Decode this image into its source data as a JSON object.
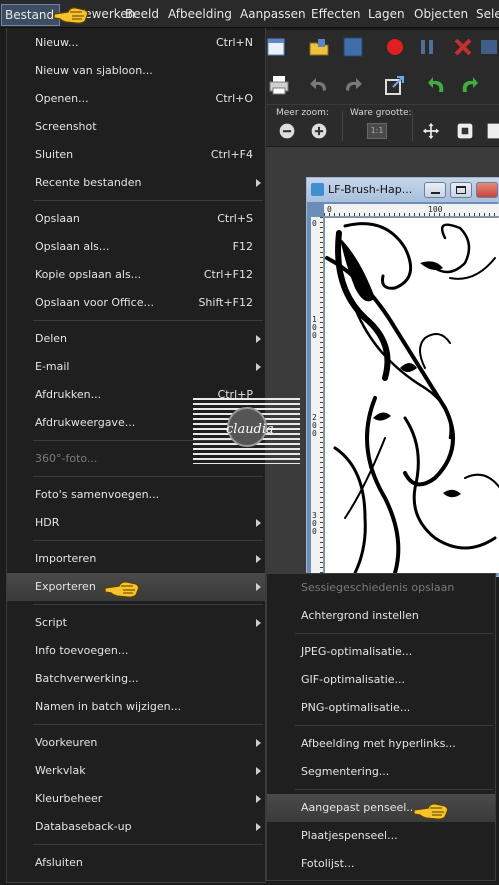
{
  "menubar": {
    "items": [
      "Bestand",
      "Bewerken",
      "Beeld",
      "Afbeelding",
      "Aanpassen",
      "Effecten",
      "Lagen",
      "Objecten",
      "Sele"
    ]
  },
  "bestand_menu": {
    "items": [
      {
        "label": "Nieuw...",
        "shortcut": "Ctrl+N"
      },
      {
        "label": "Nieuw van sjabloon...",
        "shortcut": ""
      },
      {
        "label": "Openen...",
        "shortcut": "Ctrl+O"
      },
      {
        "label": "Screenshot",
        "shortcut": ""
      },
      {
        "label": "Sluiten",
        "shortcut": "Ctrl+F4"
      },
      {
        "label": "Recente bestanden",
        "shortcut": ""
      },
      {
        "label": "Opslaan",
        "shortcut": "Ctrl+S"
      },
      {
        "label": "Opslaan als...",
        "shortcut": "F12"
      },
      {
        "label": "Kopie opslaan als...",
        "shortcut": "Ctrl+F12"
      },
      {
        "label": "Opslaan voor Office...",
        "shortcut": "Shift+F12"
      },
      {
        "label": "Delen",
        "shortcut": ""
      },
      {
        "label": "E-mail",
        "shortcut": ""
      },
      {
        "label": "Afdrukken...",
        "shortcut": "Ctrl+P"
      },
      {
        "label": "Afdrukweergave...",
        "shortcut": ""
      },
      {
        "label": "360°-foto...",
        "shortcut": ""
      },
      {
        "label": "Foto's samenvoegen...",
        "shortcut": ""
      },
      {
        "label": "HDR",
        "shortcut": ""
      },
      {
        "label": "Importeren",
        "shortcut": ""
      },
      {
        "label": "Exporteren",
        "shortcut": ""
      },
      {
        "label": "Script",
        "shortcut": ""
      },
      {
        "label": "Info toevoegen...",
        "shortcut": ""
      },
      {
        "label": "Batchverwerking...",
        "shortcut": ""
      },
      {
        "label": "Namen in batch wijzigen...",
        "shortcut": ""
      },
      {
        "label": "Voorkeuren",
        "shortcut": ""
      },
      {
        "label": "Werkvlak",
        "shortcut": ""
      },
      {
        "label": "Kleurbeheer",
        "shortcut": ""
      },
      {
        "label": "Databaseback-up",
        "shortcut": ""
      },
      {
        "label": "Afsluiten",
        "shortcut": ""
      }
    ]
  },
  "exporteren_submenu": {
    "items": [
      "Sessiegeschiedenis opslaan",
      "Achtergrond instellen",
      "JPEG-optimalisatie...",
      "GIF-optimalisatie...",
      "PNG-optimalisatie...",
      "Afbeelding met hyperlinks...",
      "Segmentering...",
      "Aangepast penseel...",
      "Plaatjespenseel...",
      "Fotolijst..."
    ]
  },
  "zoom_toolbar": {
    "zoom_more_label": "Meer zoom:",
    "actual_size_label": "Ware grootte:",
    "actual_size_button": "1:1"
  },
  "image_window": {
    "title": "LF-Brush-Hap...",
    "ruler_top": [
      "0",
      "100"
    ],
    "ruler_left": [
      "0",
      "1",
      "0",
      "0",
      "2",
      "0",
      "0",
      "3",
      "0",
      "0"
    ]
  },
  "watermark": {
    "text": "claudia"
  }
}
